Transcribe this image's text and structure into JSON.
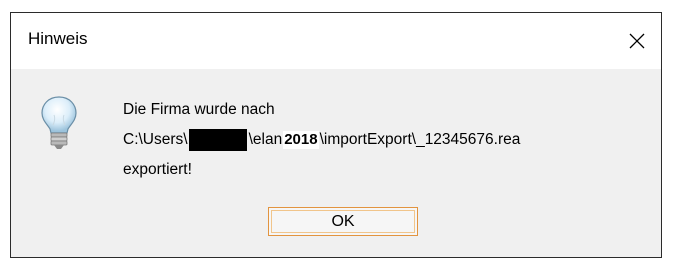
{
  "window": {
    "title": "Hinweis"
  },
  "message": {
    "line1": "Die Firma wurde nach",
    "line2_prefix": "C:\\Users\\",
    "line2_mid": "\\elan",
    "line2_overlay": "2018",
    "line2_suffix": "\\importExport\\_12345676.rea",
    "line3": "exportiert!"
  },
  "buttons": {
    "ok_label": "OK"
  },
  "icons": {
    "message_icon": "lightbulb-icon",
    "close_icon": "close-icon"
  },
  "colors": {
    "ok_border": "#e2943f",
    "dialog_body": "#f0f0f0"
  }
}
